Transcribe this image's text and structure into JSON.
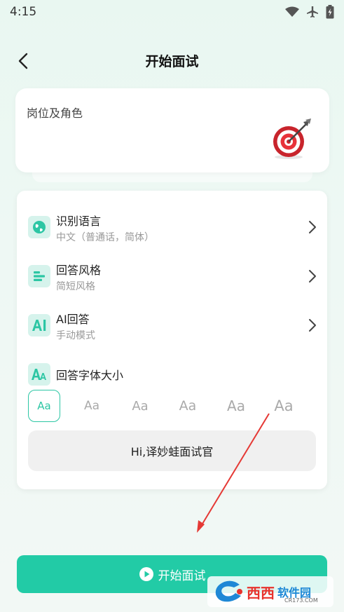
{
  "status_bar": {
    "time": "4:15",
    "icons": [
      "wifi-icon",
      "airplane-icon",
      "battery-icon"
    ]
  },
  "header": {
    "title": "开始面试",
    "back_icon": "chevron-left-icon"
  },
  "role_card": {
    "label": "岗位及角色",
    "icon": "dart-target-icon"
  },
  "settings": {
    "rows": [
      {
        "title": "识别语言",
        "subtitle": "中文（普通话，简体）",
        "icon": "globe-icon"
      },
      {
        "title": "回答风格",
        "subtitle": "简短风格",
        "icon": "align-left-icon"
      },
      {
        "title": "AI回答",
        "subtitle": "手动模式",
        "icon": "ai-icon"
      },
      {
        "title": "回答字体大小",
        "icon": "font-size-icon"
      }
    ],
    "font_options": [
      "Aa",
      "Aa",
      "Aa",
      "Aa",
      "Aa",
      "Aa"
    ],
    "selected_font_index": 0,
    "preview_text": "Hi,译妙蛙面试官"
  },
  "start_button": {
    "label": "开始面试",
    "icon": "play-circle-icon"
  },
  "watermark": {
    "brand": "西西",
    "label": "软件园",
    "url": "CR173.COM"
  },
  "colors": {
    "accent": "#22cba6",
    "icon_bg": "#d6f3ec",
    "arrow": "#e53935"
  }
}
